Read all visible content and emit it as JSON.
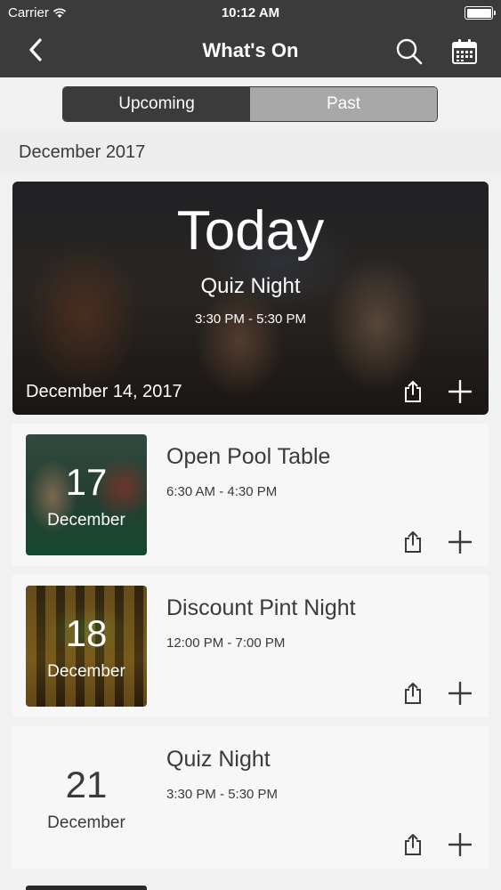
{
  "status_bar": {
    "carrier": "Carrier",
    "time": "10:12 AM"
  },
  "nav": {
    "title": "What's On",
    "icons": [
      "back-chevron-icon",
      "search-icon",
      "calendar-icon"
    ]
  },
  "tabs": [
    {
      "label": "Upcoming",
      "selected": true
    },
    {
      "label": "Past",
      "selected": false
    }
  ],
  "section": {
    "month": "December 2017"
  },
  "featured": {
    "badge": "Today",
    "title": "Quiz Night",
    "time": "3:30 PM - 5:30 PM",
    "date": "December 14, 2017"
  },
  "events": [
    {
      "day": "17",
      "month": "December",
      "title": "Open Pool Table",
      "time": "6:30 AM - 4:30 PM"
    },
    {
      "day": "18",
      "month": "December",
      "title": "Discount Pint Night",
      "time": "12:00 PM - 7:00 PM"
    },
    {
      "day": "21",
      "month": "December",
      "title": "Quiz Night",
      "time": "3:30 PM - 5:30 PM"
    }
  ],
  "colors": {
    "bar": "#3b3b3b",
    "background": "#f1f1f1",
    "card": "#f7f7f7",
    "tab_inactive": "#a8a8a8"
  }
}
